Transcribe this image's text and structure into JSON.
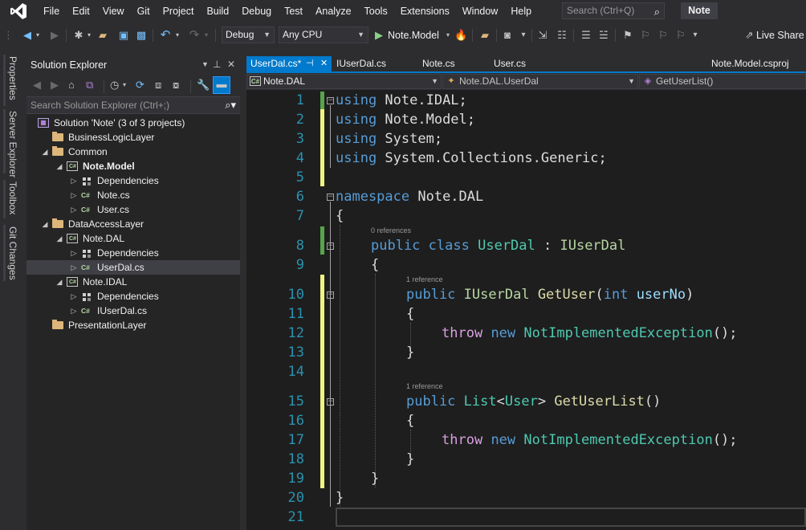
{
  "menu": {
    "items": [
      "File",
      "Edit",
      "View",
      "Git",
      "Project",
      "Build",
      "Debug",
      "Test",
      "Analyze",
      "Tools",
      "Extensions",
      "Window",
      "Help"
    ],
    "search_placeholder": "Search (Ctrl+Q)",
    "solution_name": "Note"
  },
  "toolbar": {
    "configuration": "Debug",
    "platform": "Any CPU",
    "start_target": "Note.Model",
    "live_share": "Live Share"
  },
  "side_tabs": [
    "Properties",
    "Server Explorer",
    "Toolbox",
    "Git Changes"
  ],
  "solution_explorer": {
    "title": "Solution Explorer",
    "search_placeholder": "Search Solution Explorer (Ctrl+;)",
    "tree": [
      {
        "label": "Solution 'Note' (3 of 3 projects)",
        "icon": "solution-icon",
        "depth": 0,
        "expander": "none"
      },
      {
        "label": "BusinessLogicLayer",
        "icon": "folder-icon",
        "depth": 1,
        "expander": "none"
      },
      {
        "label": "Common",
        "icon": "folder-icon",
        "depth": 1,
        "expander": "expanded"
      },
      {
        "label": "Note.Model",
        "icon": "csharp-project-icon",
        "depth": 2,
        "expander": "expanded",
        "bold": true
      },
      {
        "label": "Dependencies",
        "icon": "dependencies-icon",
        "depth": 3,
        "expander": "collapsed"
      },
      {
        "label": "Note.cs",
        "icon": "csharp-file-icon",
        "depth": 3,
        "expander": "collapsed"
      },
      {
        "label": "User.cs",
        "icon": "csharp-file-icon",
        "depth": 3,
        "expander": "collapsed"
      },
      {
        "label": "DataAccessLayer",
        "icon": "folder-icon",
        "depth": 1,
        "expander": "expanded"
      },
      {
        "label": "Note.DAL",
        "icon": "csharp-project-icon",
        "depth": 2,
        "expander": "expanded"
      },
      {
        "label": "Dependencies",
        "icon": "dependencies-icon",
        "depth": 3,
        "expander": "collapsed"
      },
      {
        "label": "UserDal.cs",
        "icon": "csharp-file-icon",
        "depth": 3,
        "expander": "collapsed",
        "selected": true
      },
      {
        "label": "Note.IDAL",
        "icon": "csharp-project-icon",
        "depth": 2,
        "expander": "expanded"
      },
      {
        "label": "Dependencies",
        "icon": "dependencies-icon",
        "depth": 3,
        "expander": "collapsed"
      },
      {
        "label": "IUserDal.cs",
        "icon": "csharp-file-icon",
        "depth": 3,
        "expander": "collapsed"
      },
      {
        "label": "PresentationLayer",
        "icon": "folder-icon",
        "depth": 1,
        "expander": "none"
      }
    ]
  },
  "editor_tabs": [
    {
      "label": "UserDal.cs*",
      "active": true
    },
    {
      "label": "IUserDal.cs",
      "active": false
    },
    {
      "label": "Note.cs",
      "active": false
    },
    {
      "label": "User.cs",
      "active": false
    },
    {
      "label": "Note.Model.csproj",
      "active": false
    }
  ],
  "navbar": {
    "project": "Note.DAL",
    "type": "Note.DAL.UserDal",
    "member": "GetUserList()"
  },
  "code": {
    "line_numbers": [
      "1",
      "2",
      "3",
      "4",
      "5",
      "6",
      "7",
      "8",
      "9",
      "10",
      "11",
      "12",
      "13",
      "14",
      "15",
      "16",
      "17",
      "18",
      "19",
      "20",
      "21"
    ],
    "lens": {
      "class_refs": "0 references",
      "getuser_refs": "1 reference",
      "getuserlist_refs": "1 reference"
    },
    "tokens": {
      "using": "using",
      "ns_idal": " Note.IDAL;",
      "ns_model": " Note.Model;",
      "ns_system": " System;",
      "ns_generic": " System.Collections.Generic;",
      "namespace": "namespace",
      "ns_dal": " Note.DAL",
      "open_brace": "{",
      "close_brace": "}",
      "public": "public",
      "class": "class",
      "class_name": "UserDal",
      "colon": " : ",
      "iuserdal": "IUserDal",
      "getuser": "GetUser",
      "paren_open": "(",
      "int": "int",
      "userno": "userNo",
      "paren_close": ")",
      "throw": "throw",
      "new": "new",
      "exception": "NotImplementedException",
      "call_end": "();",
      "list": "List",
      "lt": "<",
      "user": "User",
      "gt": ">",
      "getuserlist": "GetUserList",
      "empty_parens": "()"
    }
  }
}
